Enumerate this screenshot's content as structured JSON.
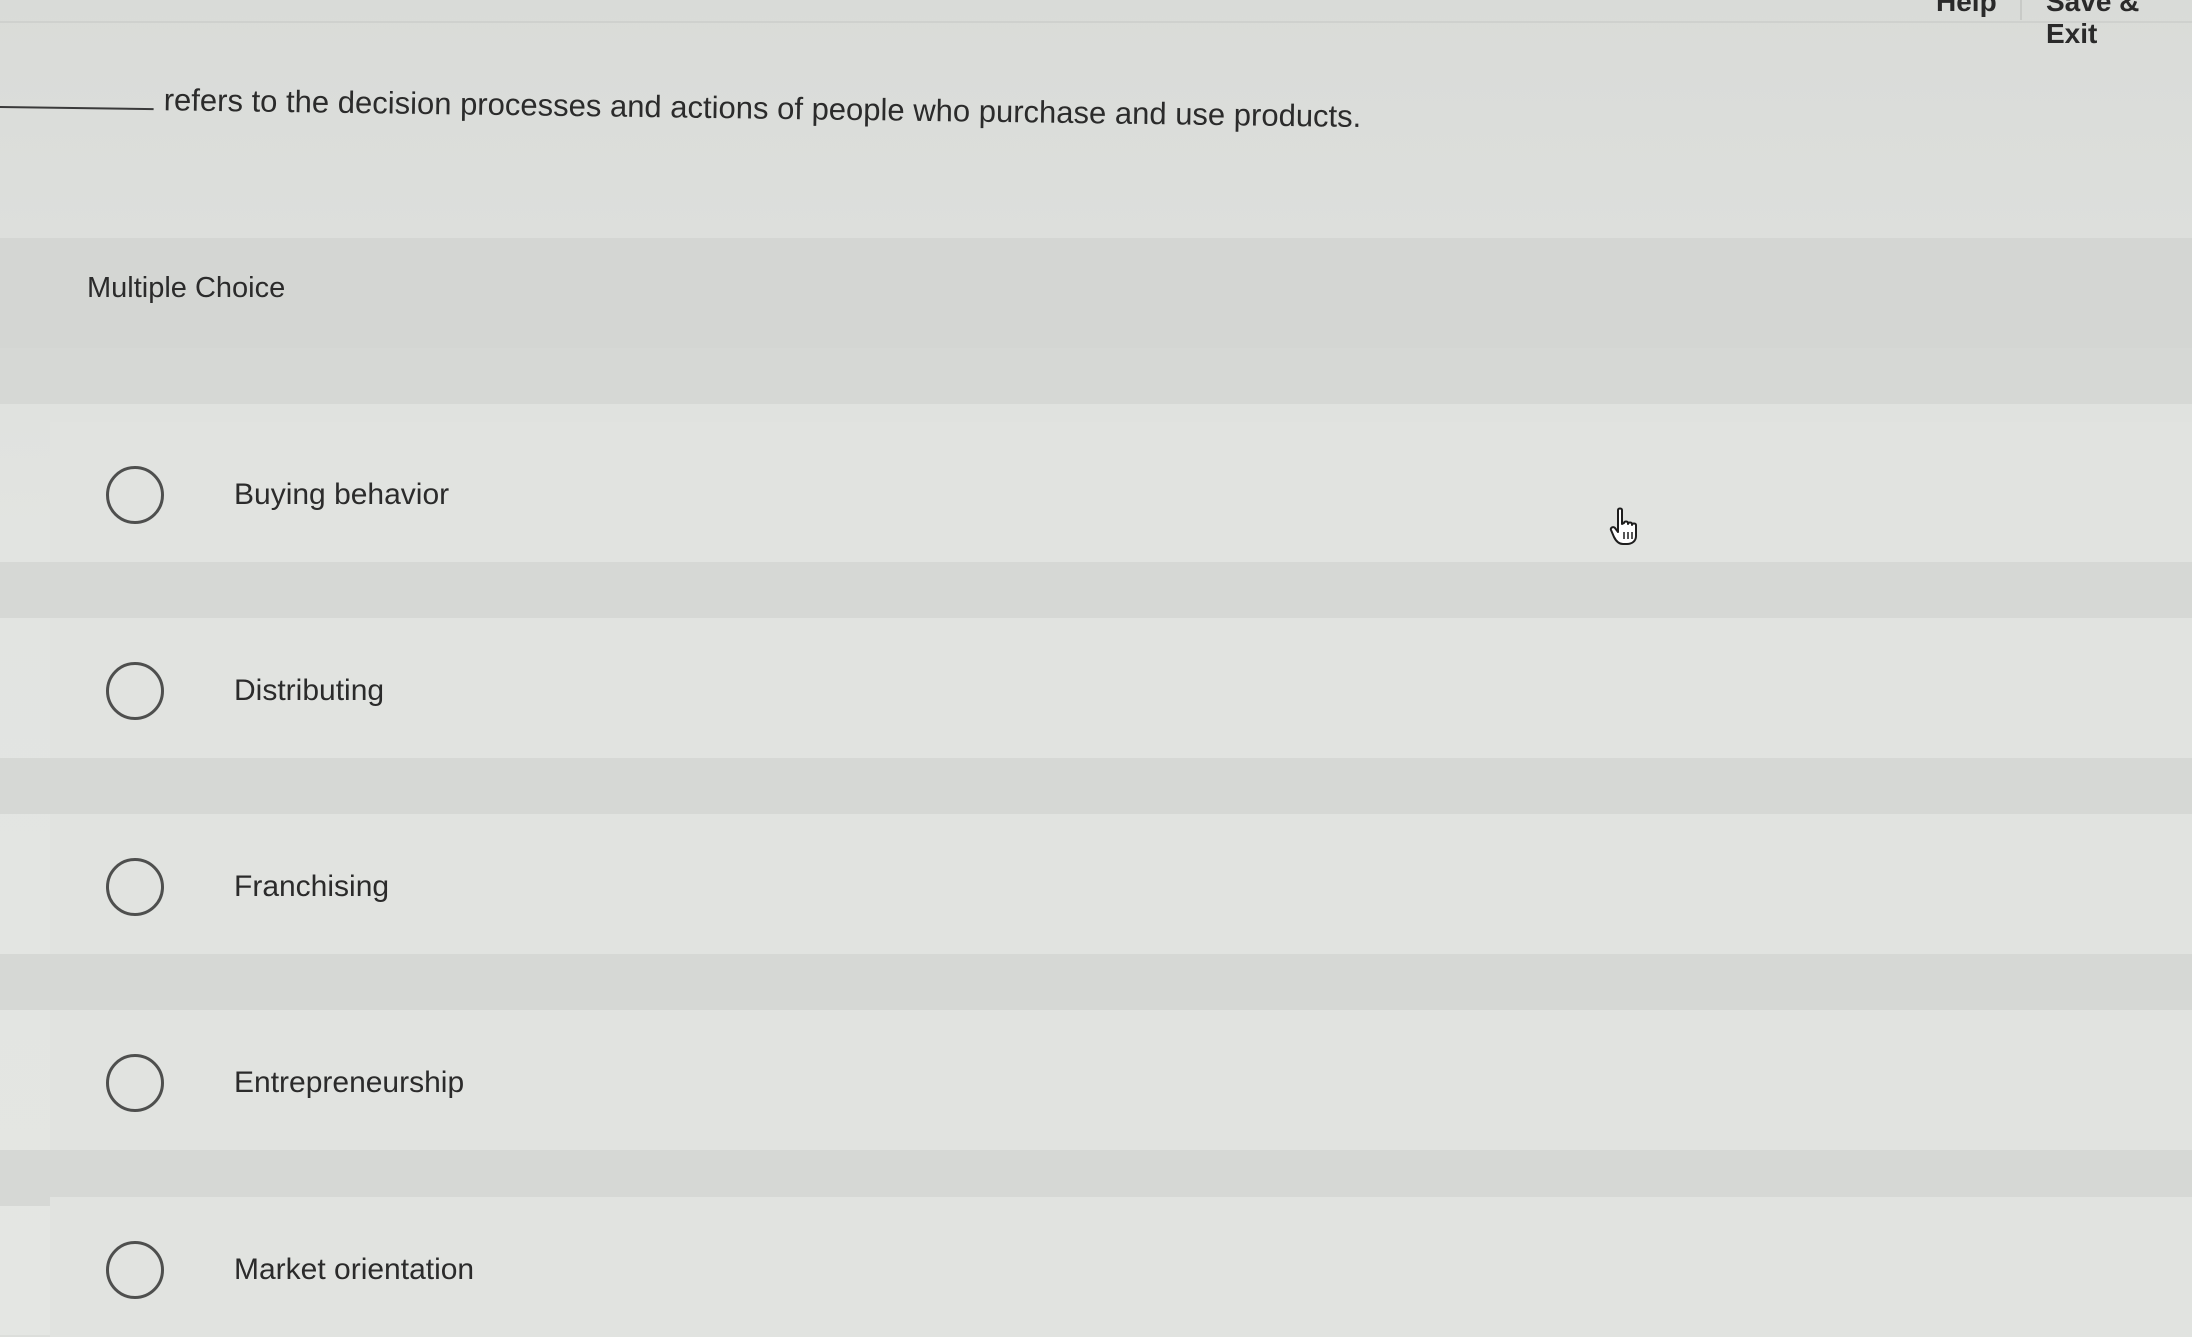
{
  "header": {
    "help_label": "Help",
    "save_exit_label": "Save & Exit"
  },
  "question": {
    "text": "refers to the decision processes and actions of people who purchase and use products."
  },
  "section": {
    "type_label": "Multiple Choice"
  },
  "choices": [
    {
      "label": "Buying behavior"
    },
    {
      "label": "Distributing"
    },
    {
      "label": "Franchising"
    },
    {
      "label": "Entrepreneurship"
    },
    {
      "label": "Market orientation"
    }
  ],
  "icons": {
    "radio": "radio-button-empty",
    "cursor": "hand-pointer-icon"
  }
}
